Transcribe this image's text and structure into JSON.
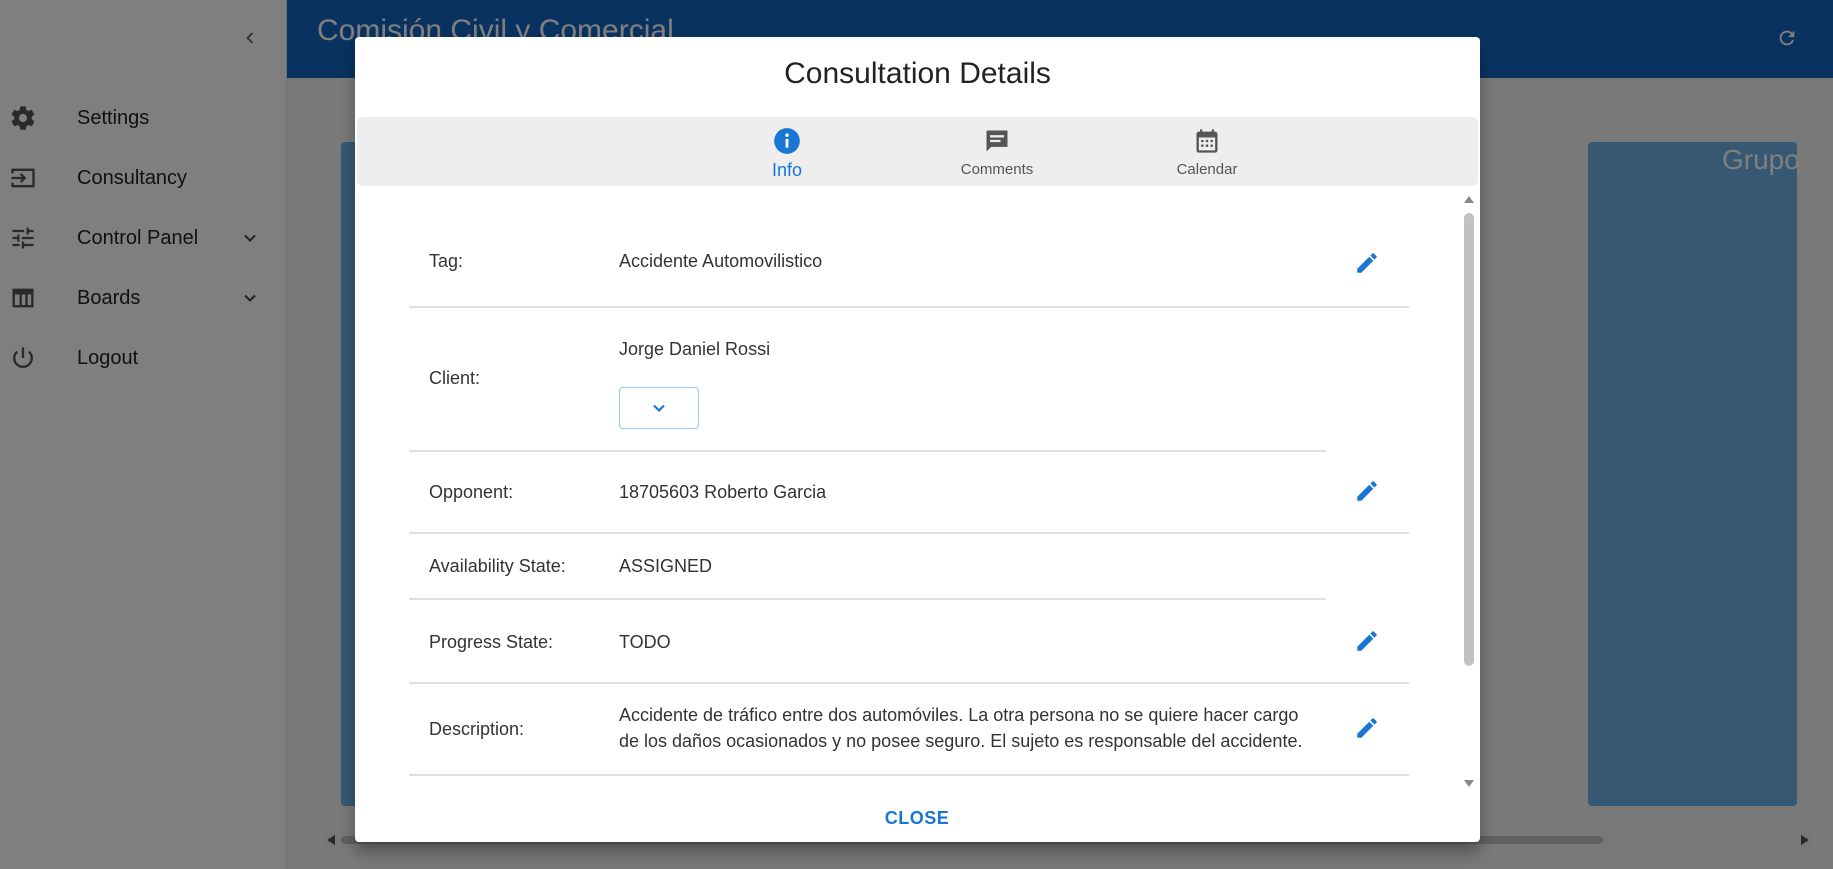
{
  "app": {
    "title": "Comisión Civil y Comercial",
    "board_column_title": "Grupo"
  },
  "sidebar": {
    "items": [
      {
        "label": "Settings",
        "icon": "gear-icon"
      },
      {
        "label": "Consultancy",
        "icon": "login-icon"
      },
      {
        "label": "Control Panel",
        "icon": "tune-icon",
        "expandable": true
      },
      {
        "label": "Boards",
        "icon": "table-icon",
        "expandable": true
      },
      {
        "label": "Logout",
        "icon": "power-icon"
      }
    ]
  },
  "dialog": {
    "title": "Consultation Details",
    "tabs": [
      {
        "label": "Info",
        "icon": "info-icon",
        "active": true
      },
      {
        "label": "Comments",
        "icon": "comment-icon",
        "active": false
      },
      {
        "label": "Calendar",
        "icon": "calendar-icon",
        "active": false
      }
    ],
    "fields": {
      "tag": {
        "label": "Tag:",
        "value": "Accidente Automovilistico"
      },
      "client": {
        "label": "Client:",
        "value": "Jorge Daniel Rossi"
      },
      "opponent": {
        "label": "Opponent:",
        "value": "18705603 Roberto Garcia"
      },
      "availability": {
        "label": "Availability State:",
        "value": "ASSIGNED"
      },
      "progress": {
        "label": "Progress State:",
        "value": "TODO"
      },
      "description": {
        "label": "Description:",
        "value": "Accidente de tráfico entre dos automóviles. La otra persona no se quiere hacer cargo de los daños ocasionados y no posee seguro. El sujeto es responsable del accidente."
      }
    },
    "close_label": "CLOSE"
  },
  "colors": {
    "primary": "#1976d2",
    "appbar": "#1565c0",
    "board_column": "#6fb1e4"
  }
}
